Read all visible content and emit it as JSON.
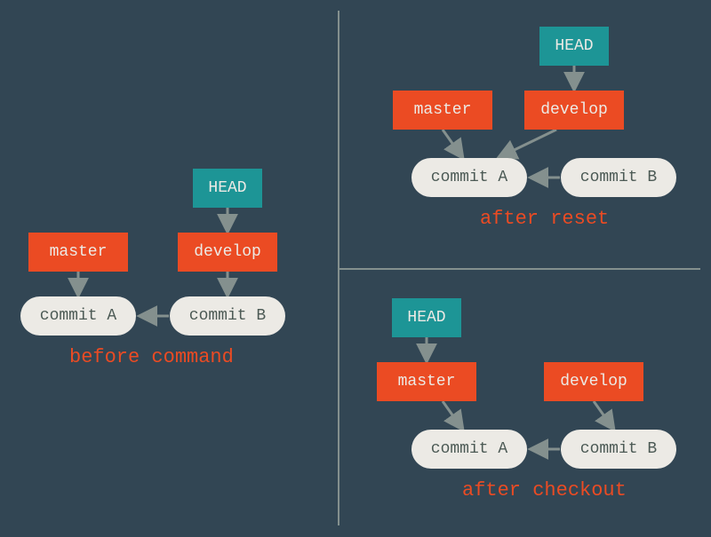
{
  "labels": {
    "head": "HEAD",
    "master": "master",
    "develop": "develop",
    "commitA": "commit A",
    "commitB": "commit B"
  },
  "captions": {
    "before": "before command",
    "afterReset": "after reset",
    "afterCheckout": "after checkout"
  },
  "colors": {
    "head": "#1d9596",
    "branch": "#eb4b23",
    "commit_bg": "#eceae5",
    "commit_text": "#4c5a55",
    "caption": "#eb4b23",
    "arrow": "#84908e",
    "background": "#324654"
  },
  "structure": {
    "before": {
      "head_points_to": "develop",
      "master_points_to": "commitA",
      "develop_points_to": "commitB",
      "commitB_parent": "commitA"
    },
    "after_reset": {
      "head_points_to": "develop",
      "master_points_to": "commitA",
      "develop_points_to": "commitA",
      "commitB_parent": "commitA"
    },
    "after_checkout": {
      "head_points_to": "master",
      "master_points_to": "commitA",
      "develop_points_to": "commitB",
      "commitB_parent": "commitA"
    }
  }
}
